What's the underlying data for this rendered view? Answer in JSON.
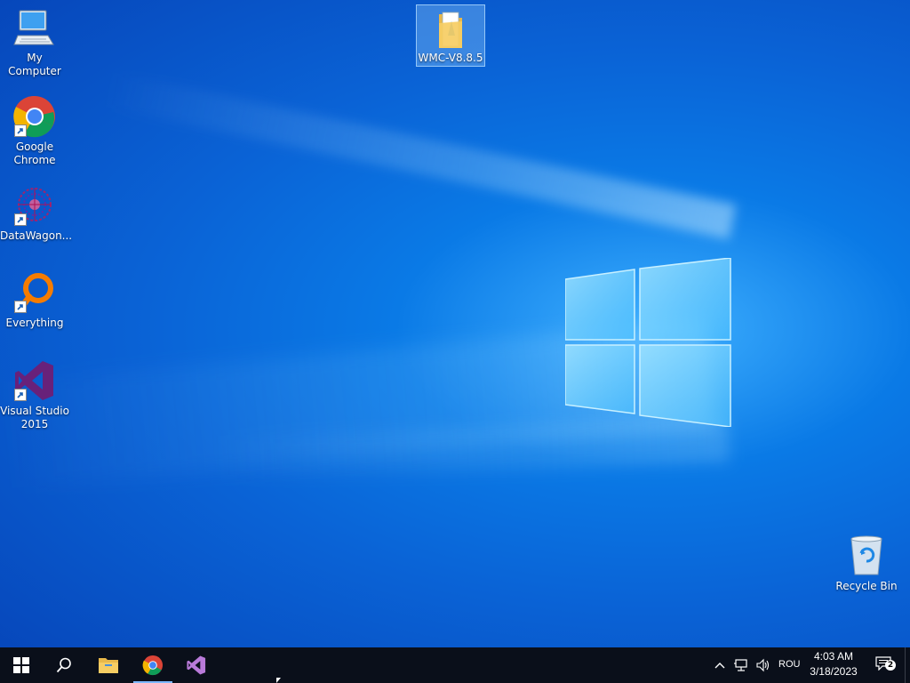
{
  "desktop": {
    "icons": [
      {
        "label": "My Computer",
        "icon": "computer-icon"
      },
      {
        "label": "Google\nChrome",
        "icon": "chrome-icon"
      },
      {
        "label": "DataWagon...",
        "icon": "datawagon-icon"
      },
      {
        "label": "Everything",
        "icon": "everything-icon"
      },
      {
        "label": "Visual Studio\n2015",
        "icon": "visual-studio-icon"
      },
      {
        "label": "WMC-V8.8.5",
        "icon": "folder-icon"
      },
      {
        "label": "Recycle Bin",
        "icon": "recycle-bin-icon"
      }
    ]
  },
  "taskbar": {
    "pinned": [
      "start-icon",
      "search-icon",
      "file-explorer-icon",
      "chrome-icon",
      "visual-studio-icon"
    ],
    "tray": {
      "language": "ROU",
      "time": "4:03 AM",
      "date": "3/18/2023",
      "notification_count": "2"
    }
  },
  "colors": {
    "taskbar": "#0a0f1a",
    "desktop_blue": "#0a63d6",
    "accent": "#7db8ff"
  }
}
